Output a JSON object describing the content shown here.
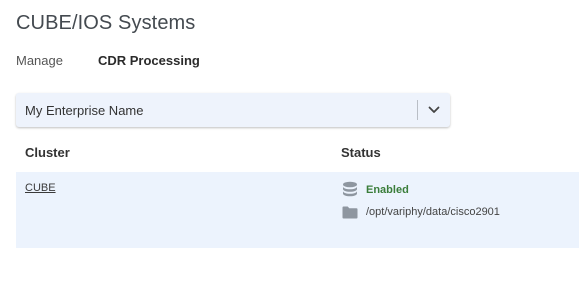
{
  "page": {
    "title": "CUBE/IOS Systems"
  },
  "nav": {
    "items": [
      {
        "label": "Manage"
      },
      {
        "label": "CDR Processing"
      }
    ]
  },
  "enterprise_select": {
    "value": "My Enterprise Name",
    "icon": "chevron-down-icon"
  },
  "table": {
    "columns": [
      "Cluster",
      "Status"
    ],
    "rows": [
      {
        "cluster": "CUBE",
        "status": "Enabled",
        "status_icon": "database-icon",
        "path": "/opt/variphy/data/cisco2901",
        "path_icon": "folder-icon"
      }
    ]
  },
  "colors": {
    "row_background": "#ecf3fd",
    "enabled_text": "#3a7d3a",
    "icon_gray": "#8e96a0"
  }
}
